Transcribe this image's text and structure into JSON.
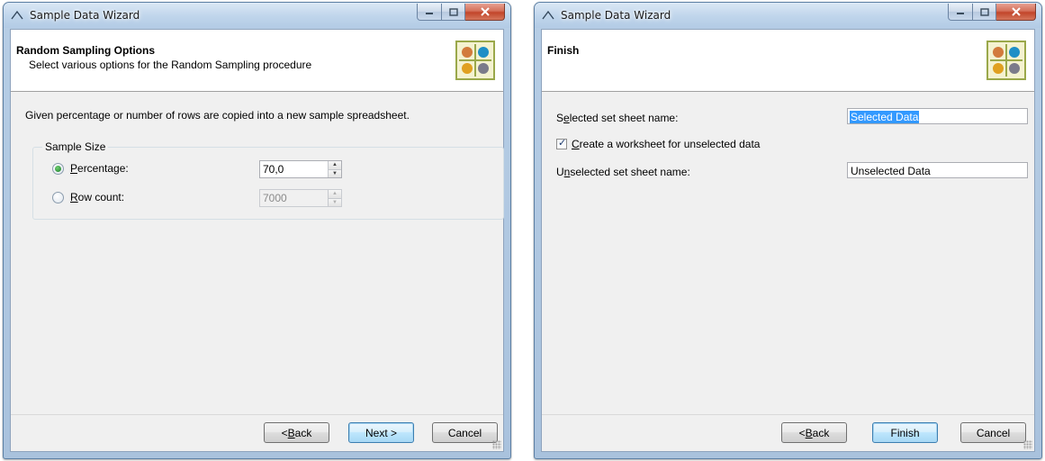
{
  "windows": [
    {
      "title": "Sample Data Wizard",
      "header": {
        "title": "Random Sampling Options",
        "subtitle": "Select various options for the Random Sampling procedure"
      },
      "description": "Given percentage or number of rows are copied into a new sample spreadsheet.",
      "group": {
        "label": "Sample Size",
        "options": [
          {
            "label_prefix": "",
            "mnemonic": "P",
            "label_rest": "ercentage:",
            "selected": true,
            "value": "70,0",
            "enabled": true
          },
          {
            "label_prefix": "",
            "mnemonic": "R",
            "label_rest": "ow count:",
            "selected": false,
            "value": "7000",
            "enabled": false
          }
        ]
      },
      "buttons": {
        "back": {
          "prefix": "< ",
          "mnemonic": "B",
          "rest": "ack"
        },
        "next": "Next >",
        "cancel": "Cancel"
      }
    },
    {
      "title": "Sample Data Wizard",
      "header": {
        "title": "Finish",
        "subtitle": ""
      },
      "fields": {
        "selected_label": {
          "prefix": "S",
          "mnemonic": "e",
          "rest": "lected set sheet name:"
        },
        "selected_value": "Selected Data",
        "checkbox": {
          "prefix": "",
          "mnemonic": "C",
          "rest": "reate a worksheet for unselected data",
          "checked": true
        },
        "unselected_label": {
          "prefix": "U",
          "mnemonic": "n",
          "rest": "selected set sheet name:"
        },
        "unselected_value": "Unselected Data"
      },
      "buttons": {
        "back": {
          "prefix": "< ",
          "mnemonic": "B",
          "rest": "ack"
        },
        "finish": "Finish",
        "cancel": "Cancel"
      }
    }
  ],
  "icons": {
    "title_icon": "wizard-wand-icon",
    "logo": "four-colored-balls-logo",
    "logo_colors": [
      "#d27a3c",
      "#1e8fc6",
      "#e0a020",
      "#7b7b8a"
    ]
  }
}
